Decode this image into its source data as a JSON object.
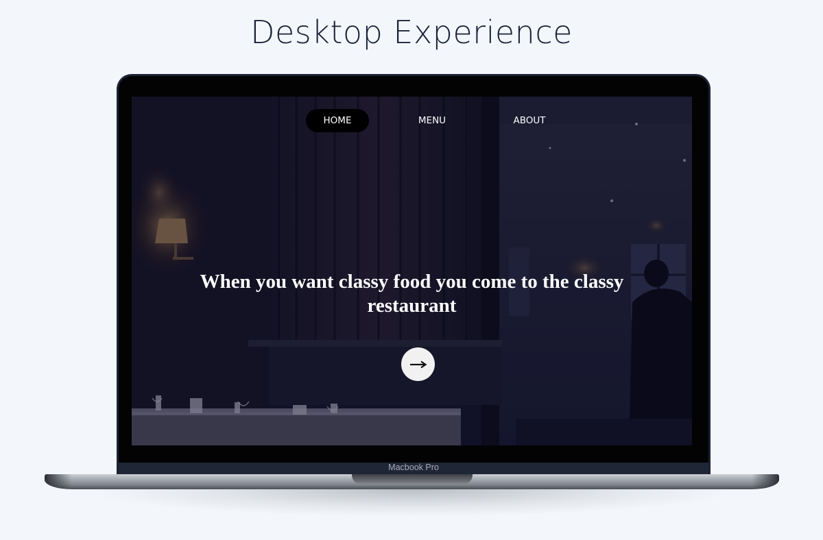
{
  "page": {
    "title": "Desktop Experience"
  },
  "device": {
    "label": "Macbook Pro"
  },
  "site": {
    "nav": [
      {
        "label": "HOME",
        "active": true
      },
      {
        "label": "MENU",
        "active": false
      },
      {
        "label": "ABOUT",
        "active": false
      }
    ],
    "hero": {
      "heading": "When you want classy food you come to the classy restaurant",
      "button_icon": "arrow-right-icon"
    }
  },
  "colors": {
    "page_background": "#f3f7fb",
    "active_nav_background": "#000000",
    "hero_text": "#ffffff",
    "overlay_tint": "#0a0c28"
  }
}
